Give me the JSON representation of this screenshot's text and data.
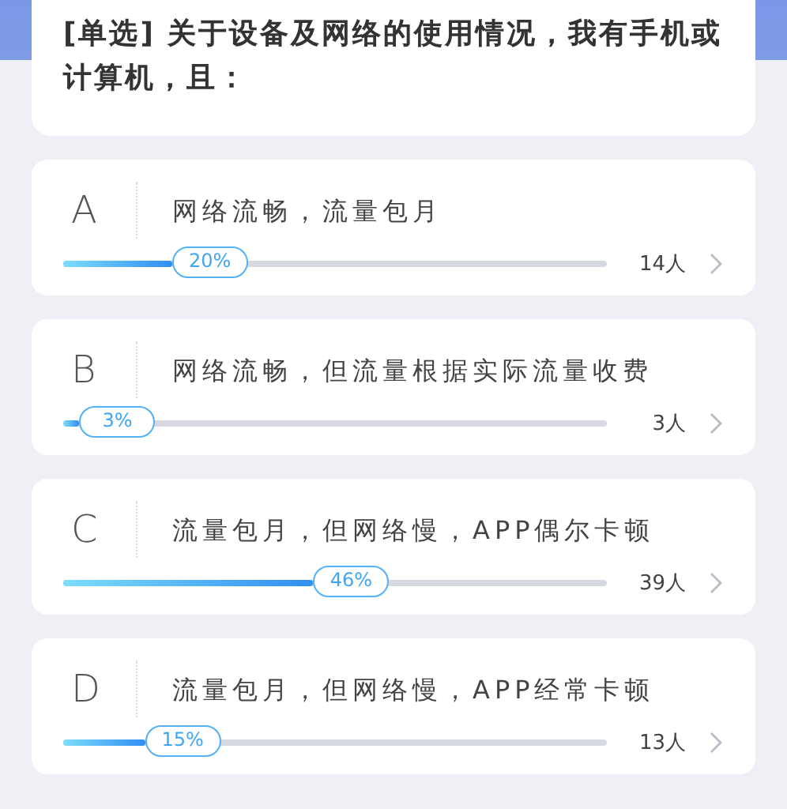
{
  "question": {
    "text": "[单选] 关于设备及网络的使用情况，我有手机或计算机，且："
  },
  "options": [
    {
      "letter": "A",
      "text": "网络流畅，流量包月",
      "level": 0.2,
      "percent": "20%",
      "count": "14人"
    },
    {
      "letter": "B",
      "text": "网络流畅，但流量根据实际流量收费",
      "level": 0.03,
      "percent": "3%",
      "count": "3人"
    },
    {
      "letter": "C",
      "text": "流量包月，但网络慢，APP偶尔卡顿",
      "level": 0.46,
      "percent": "46%",
      "count": "39人"
    },
    {
      "letter": "D",
      "text": "流量包月，但网络慢，APP经常卡顿",
      "level": 0.15,
      "percent": "15%",
      "count": "13人"
    }
  ]
}
